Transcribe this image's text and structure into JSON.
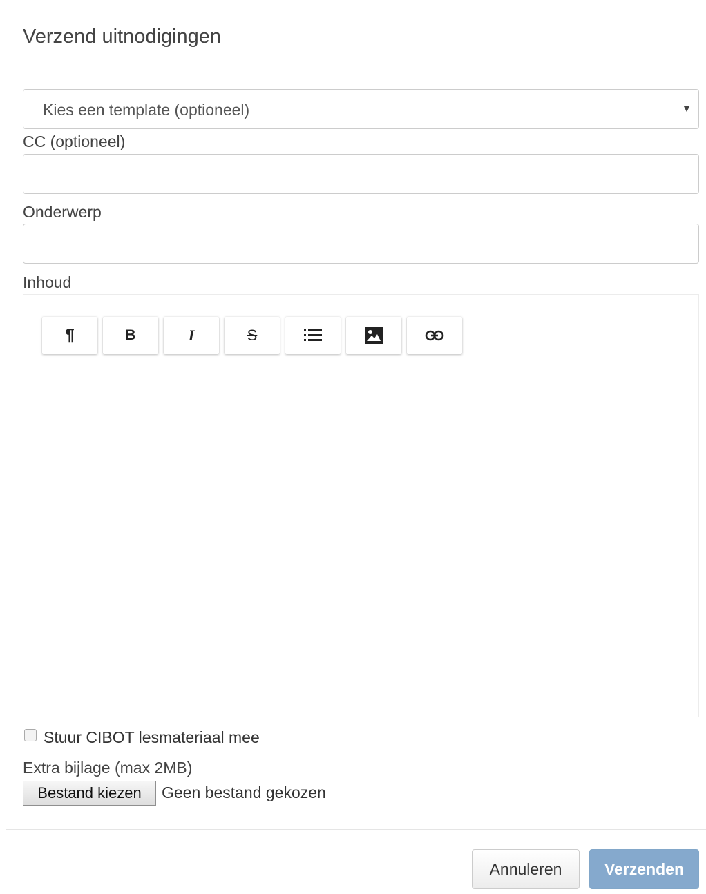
{
  "dialog": {
    "title": "Verzend uitnodigingen"
  },
  "form": {
    "template_select": {
      "selected": "Kies een template (optioneel)"
    },
    "cc": {
      "label": "CC (optioneel)",
      "value": ""
    },
    "subject": {
      "label": "Onderwerp",
      "value": ""
    },
    "content": {
      "label": "Inhoud",
      "value": ""
    },
    "toolbar": [
      {
        "name": "paragraph-icon",
        "glyph": "¶"
      },
      {
        "name": "bold-icon",
        "glyph": "B"
      },
      {
        "name": "italic-icon",
        "glyph": "I"
      },
      {
        "name": "strikethrough-icon",
        "glyph": "S"
      },
      {
        "name": "list-icon",
        "glyph": "list"
      },
      {
        "name": "image-icon",
        "glyph": "image"
      },
      {
        "name": "link-icon",
        "glyph": "link"
      }
    ],
    "include_material": {
      "label": "Stuur CIBOT lesmateriaal mee",
      "checked": false
    },
    "attachment": {
      "label": "Extra bijlage (max 2MB)",
      "button_label": "Bestand kiezen",
      "status": "Geen bestand gekozen"
    }
  },
  "footer": {
    "cancel_label": "Annuleren",
    "send_label": "Verzenden"
  },
  "colors": {
    "primary_disabled": "#85a9cd",
    "border": "#cccccc"
  }
}
